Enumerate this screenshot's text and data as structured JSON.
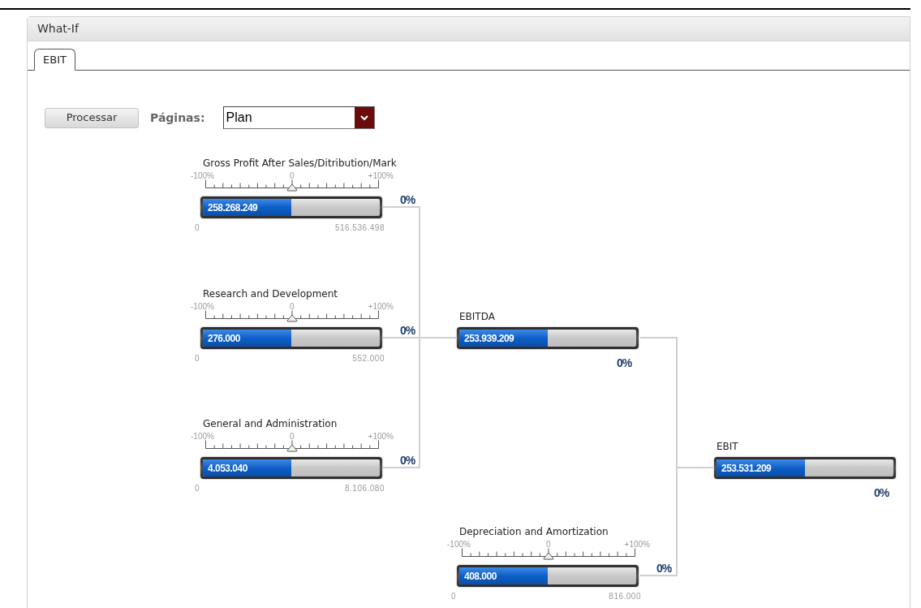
{
  "window": {
    "title": "What-If"
  },
  "tabs": [
    {
      "label": "EBIT",
      "selected": true
    }
  ],
  "toolbar": {
    "button": "Processar",
    "pages_label": "Páginas:",
    "pages_value": "Plan"
  },
  "nodes": [
    {
      "kind": "slider",
      "label": "Gross Profit After Sales/Ditribution/Mark",
      "slider": {
        "level": 0.5,
        "labels": [
          "-100%",
          "0",
          "+100%"
        ]
      },
      "bar": {
        "value": "258.268.249",
        "level": 0.5
      },
      "min": "0",
      "max": "516.536.498",
      "percent": "0%"
    },
    {
      "kind": "slider",
      "label": "Research and Development",
      "slider": {
        "level": 0.5,
        "labels": [
          "-100%",
          "0",
          "+100%"
        ]
      },
      "bar": {
        "value": "276.000",
        "level": 0.5
      },
      "min": "0",
      "max": "552.000",
      "percent": "0%"
    },
    {
      "kind": "slider",
      "label": "General and Administration",
      "slider": {
        "level": 0.5,
        "labels": [
          "-100%",
          "0",
          "+100%"
        ]
      },
      "bar": {
        "value": "4.053.040",
        "level": 0.5
      },
      "min": "0",
      "max": "8.106.080",
      "percent": "0%"
    },
    {
      "kind": "total",
      "label": "EBITDA",
      "bar": {
        "value": "253.939.209",
        "level": 0.5
      },
      "percent": "0%"
    },
    {
      "kind": "total",
      "label": "EBIT",
      "bar": {
        "value": "253.531.209",
        "level": 0.5
      },
      "percent": "0%"
    },
    {
      "kind": "slider",
      "label": "Depreciation and Amortization",
      "slider": {
        "level": 0.5,
        "labels": [
          "-100%",
          "0",
          "+100%"
        ]
      },
      "bar": {
        "value": "408.000",
        "level": 0.5
      },
      "min": "0",
      "max": "816.000",
      "percent": "0%"
    }
  ]
}
